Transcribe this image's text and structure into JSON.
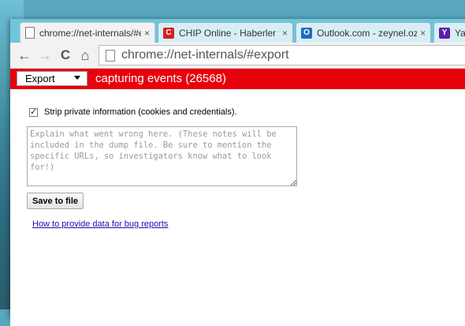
{
  "tabs": [
    {
      "title": "chrome://net-internals/#e",
      "favicon": "page-icon",
      "active": true
    },
    {
      "title": "CHIP Online - Haberler ve",
      "favicon": "chip-icon",
      "active": false
    },
    {
      "title": "Outlook.com - zeynel.oztu",
      "favicon": "outlook-icon",
      "active": false
    },
    {
      "title": "Ya",
      "favicon": "yahoo-icon",
      "active": false
    }
  ],
  "tab_close": "×",
  "favicon_letters": {
    "chip": "C",
    "outlook": "O",
    "yahoo": "Y"
  },
  "nav": {
    "back": "←",
    "forward": "→",
    "reload": "C",
    "home": "⌂"
  },
  "address": {
    "url": "chrome://net-internals/#export"
  },
  "topbar": {
    "selector_value": "Export",
    "status": "capturing events (26568)",
    "color": "#e8000d"
  },
  "export": {
    "strip_label": "Strip private information (cookies and credentials).",
    "strip_checked": true,
    "notes_placeholder": "Explain what went wrong here. (These notes will be included in the dump file. Be sure to mention the specific URLs, so investigators know what to look for!)",
    "save_label": "Save to file",
    "help_link": "How to provide data for bug reports"
  }
}
